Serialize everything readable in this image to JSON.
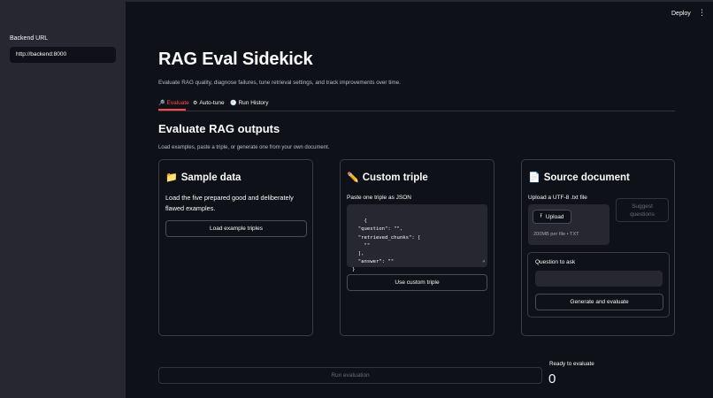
{
  "header": {
    "deploy_label": "Deploy",
    "menu_icon": "kebab-menu-icon"
  },
  "sidebar": {
    "backend_label": "Backend URL",
    "backend_value": "http://backend:8000"
  },
  "main": {
    "title": "RAG Eval Sidekick",
    "subtitle": "Evaluate RAG quality, diagnose failures, tune retrieval settings, and track improvements over time.",
    "tabs": [
      {
        "label": "Evaluate",
        "icon": "magnifier-icon",
        "active": true
      },
      {
        "label": "Auto-tune",
        "icon": "gear-icon",
        "active": false
      },
      {
        "label": "Run History",
        "icon": "clock-icon",
        "active": false
      }
    ],
    "section_title": "Evaluate RAG outputs",
    "section_caption": "Load examples, paste a triple, or generate one from your own document."
  },
  "cards": {
    "sample": {
      "title": "Sample data",
      "icon": "folder-icon",
      "description": "Load the five prepared good and deliberately flawed examples.",
      "button": "Load example triples"
    },
    "custom": {
      "title": "Custom triple",
      "icon": "pencil-icon",
      "field_label": "Paste one triple as JSON",
      "json_text": "{\n  \"question\": \"\",\n  \"retrieved_chunks\": [\n    \"\"\n  ],\n  \"answer\": \"\"\n}",
      "button": "Use custom triple"
    },
    "source": {
      "title": "Source document",
      "icon": "document-icon",
      "upload_label": "Upload a UTF-8 .txt file",
      "upload_button": "Upload",
      "upload_hint": "200MB per file • TXT",
      "suggest_button": "Suggest questions",
      "question_label": "Question to ask",
      "question_value": "",
      "generate_button": "Generate and evaluate"
    }
  },
  "footer": {
    "run_button": "Run evaluation",
    "metric_label": "Ready to evaluate",
    "metric_value": "0"
  },
  "colors": {
    "accent": "#ff4b4b",
    "background": "#0e1117",
    "sidebar": "#262730"
  }
}
